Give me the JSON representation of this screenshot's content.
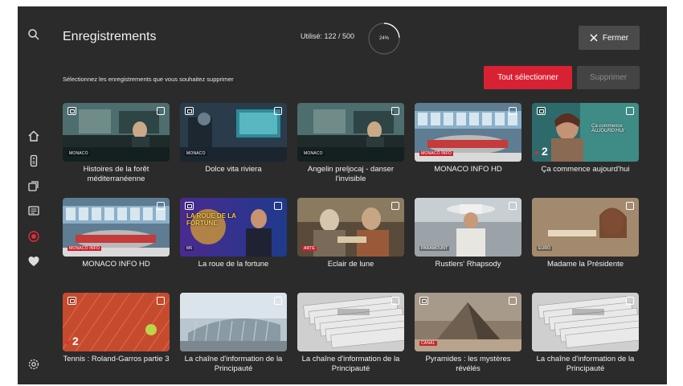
{
  "header": {
    "title": "Enregistrements",
    "usage_label": "Utilisé: 122 / 500",
    "usage_percent_label": "24%",
    "usage_fraction": 0.24,
    "close_label": "Fermer"
  },
  "toolbar": {
    "instruction": "Sélectionnez les enregistrements que vous souhaitez supprimer",
    "select_all_label": "Tout sélectionner",
    "delete_label": "Supprimer"
  },
  "sidebar": {
    "icons": [
      "search-icon",
      "home-icon",
      "remote-icon",
      "library-icon",
      "guide-icon",
      "record-icon",
      "favorites-icon",
      "settings-icon"
    ]
  },
  "colors": {
    "accent": "#d82233",
    "background": "#2b2b2b",
    "button": "#4a4a4a"
  },
  "recordings": [
    {
      "title": "Histoires de la forêt méditerranéenne",
      "channel": "MONACO",
      "series": true
    },
    {
      "title": "Dolce vita riviera",
      "channel": "MONACO",
      "series": true
    },
    {
      "title": "Angelin preljocaj - danser l'invisible",
      "channel": "MONACO",
      "series": false
    },
    {
      "title": "MONACO INFO HD",
      "channel": "MONACO INFO",
      "series": false
    },
    {
      "title": "Ça commence aujourd'hui",
      "channel": "2",
      "series": true,
      "overlay": "Ça commence AUJOURD'HUI"
    },
    {
      "title": "MONACO INFO HD",
      "channel": "MONACO INFO",
      "series": false
    },
    {
      "title": "La roue de la fortune",
      "channel": "M6",
      "series": true,
      "overlay": "LA ROUE DE LA FORTUNE"
    },
    {
      "title": "Eclair de lune",
      "channel": "ARTE",
      "series": false
    },
    {
      "title": "Rustlers' Rhapsody",
      "channel": "PARAMOUNT",
      "series": false
    },
    {
      "title": "Madame la Présidente",
      "channel": "EURO",
      "series": false
    },
    {
      "title": "Tennis : Roland-Garros partie 3",
      "channel": "2",
      "series": true
    },
    {
      "title": "La chaîne d'information de la Principauté",
      "channel": "",
      "series": false
    },
    {
      "title": "La chaîne d'information de la Principauté",
      "channel": "",
      "series": false
    },
    {
      "title": "Pyramides : les mystères révélés",
      "channel": "CANAL",
      "series": true
    },
    {
      "title": "La chaîne d'information de la Principauté",
      "channel": "",
      "series": false
    }
  ]
}
